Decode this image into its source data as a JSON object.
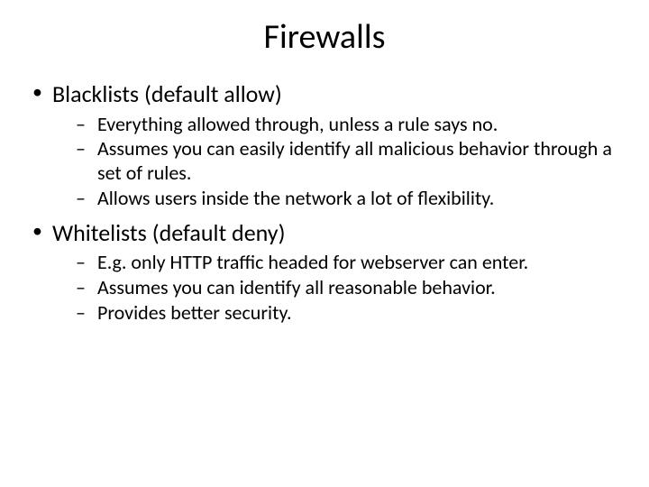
{
  "title": "Firewalls",
  "sections": [
    {
      "heading": "Blacklists (default allow)",
      "items": [
        "Everything allowed through, unless a rule says no.",
        "Assumes you can easily identify all malicious behavior through a set of rules.",
        "Allows users inside the network a lot of flexibility."
      ]
    },
    {
      "heading": "Whitelists (default deny)",
      "items": [
        "E.g. only HTTP traffic headed for webserver can enter.",
        "Assumes you can identify all reasonable behavior.",
        "Provides better security."
      ]
    }
  ]
}
